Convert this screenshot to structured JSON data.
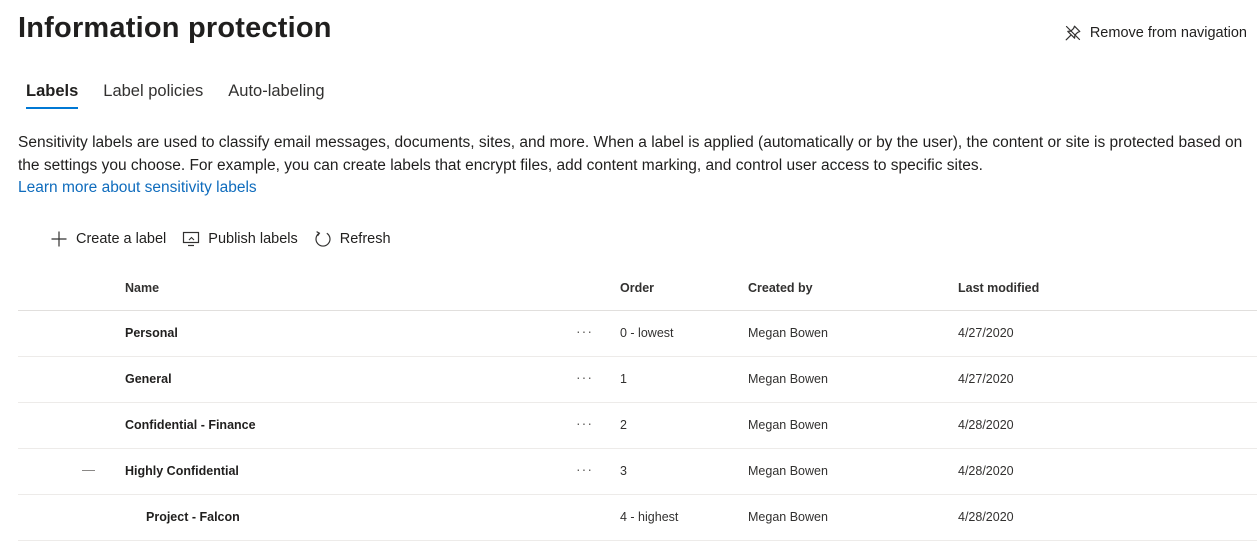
{
  "page": {
    "title": "Information protection",
    "remove_nav_label": "Remove from navigation"
  },
  "tabs": [
    {
      "label": "Labels",
      "active": true
    },
    {
      "label": "Label policies",
      "active": false
    },
    {
      "label": "Auto-labeling",
      "active": false
    }
  ],
  "description": {
    "text": "Sensitivity labels are used to classify email messages, documents, sites, and more. When a label is applied (automatically or by the user), the content or site is protected based on the settings you choose. For example, you can create labels that encrypt files, add content marking, and control user access to specific sites.",
    "link_text": "Learn more about sensitivity labels"
  },
  "toolbar": {
    "create_label": "Create a label",
    "publish_labels": "Publish labels",
    "refresh": "Refresh"
  },
  "table": {
    "columns": {
      "name": "Name",
      "order": "Order",
      "created_by": "Created by",
      "last_modified": "Last modified"
    },
    "rows": [
      {
        "name": "Personal",
        "more": "···",
        "order": "0 - lowest",
        "created_by": "Megan Bowen",
        "last_modified": "4/27/2020"
      },
      {
        "name": "General",
        "more": "···",
        "order": "1",
        "created_by": "Megan Bowen",
        "last_modified": "4/27/2020"
      },
      {
        "name": "Confidential - Finance",
        "more": "···",
        "order": "2",
        "created_by": "Megan Bowen",
        "last_modified": "4/28/2020"
      },
      {
        "name": "Highly Confidential",
        "more": "···",
        "order": "3",
        "created_by": "Megan Bowen",
        "last_modified": "4/28/2020"
      },
      {
        "name": "Project - Falcon",
        "more": "",
        "order": "4 - highest",
        "created_by": "Megan Bowen",
        "last_modified": "4/28/2020"
      }
    ]
  },
  "colors": {
    "accent": "#0078d4",
    "link": "#0f6cbd"
  }
}
